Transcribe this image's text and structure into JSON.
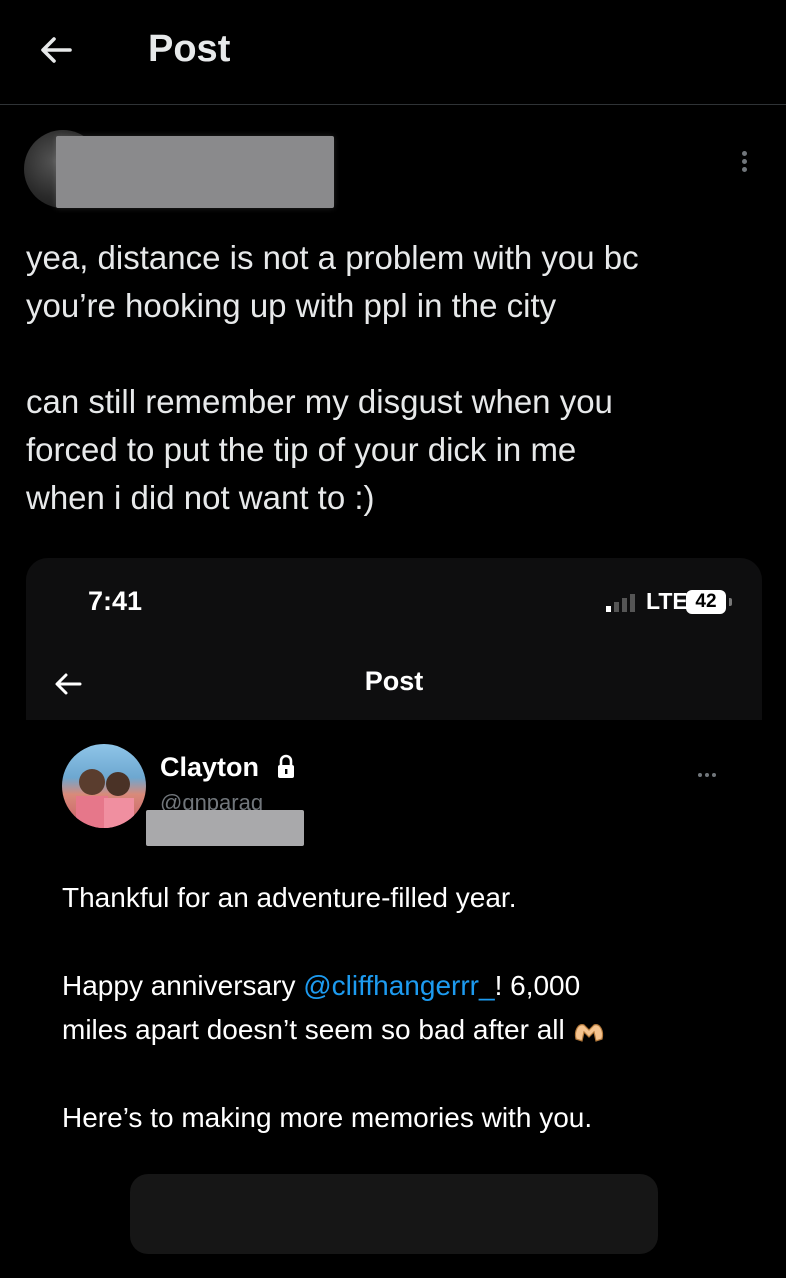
{
  "header": {
    "title": "Post"
  },
  "post": {
    "text": "yea, distance is not a problem with you bc\nyou’re hooking up with ppl in the city\n\ncan still remember my disgust when you\nforced to put the tip of your dick in me\nwhen i did not want to :)"
  },
  "embed": {
    "status_time": "7:41",
    "network": "LTE",
    "battery": "42",
    "title": "Post",
    "author_name": "Clayton",
    "author_handle": "@gnparag",
    "line1": "Thankful for an adventure-filled year.",
    "line2_prefix": "Happy anniversary ",
    "mention": "@cliffhangerrr_",
    "line2_suffix": "! 6,000",
    "line3": "miles apart doesn’t seem so bad after all",
    "line4": "Here’s to making more memories with you."
  },
  "icons": {
    "back": "back-arrow-icon",
    "more": "more-options-icon",
    "lock": "lock-icon",
    "signal": "signal-icon",
    "heart_hands": "heart-hands-icon"
  }
}
